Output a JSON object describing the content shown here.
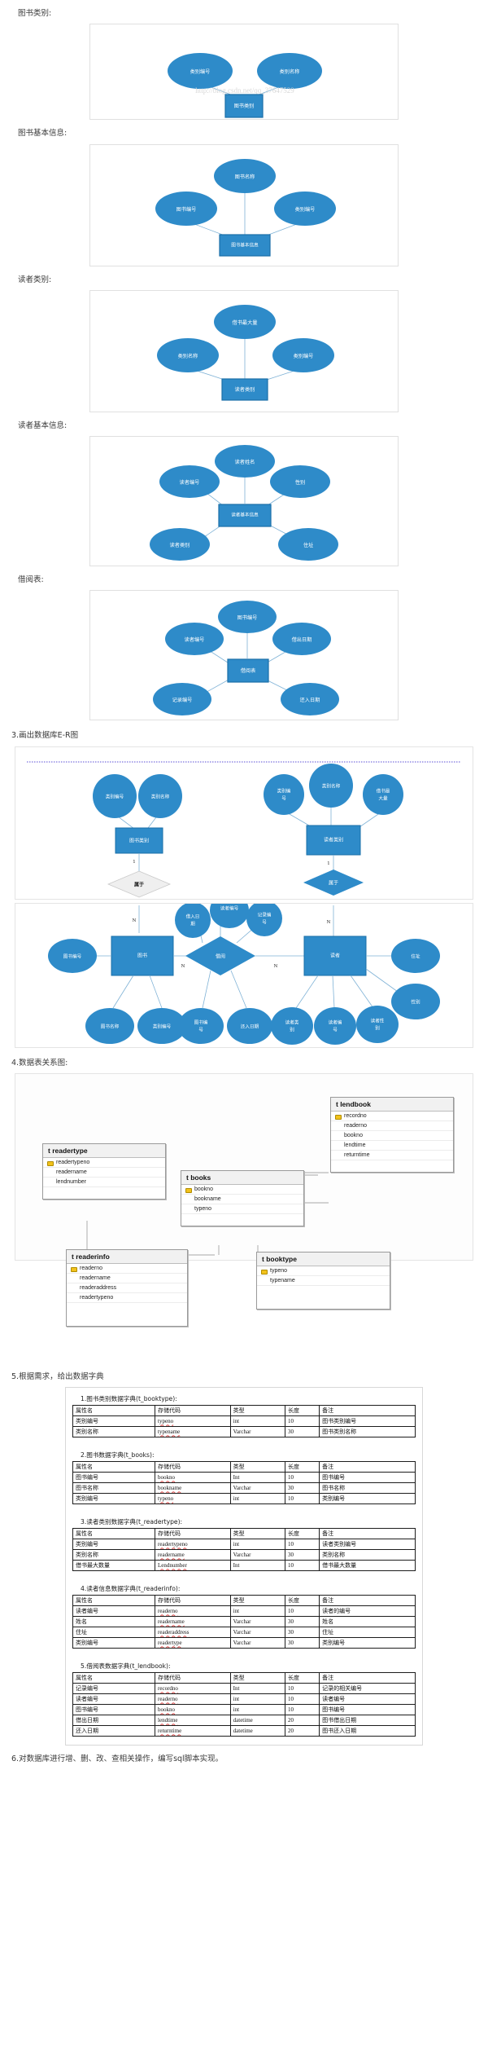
{
  "watermark": "http://blog.csdn.net/qq_37647529",
  "sections": {
    "booktype_label": "图书类别:",
    "bookinfo_label": "图书基本信息:",
    "readertype_label": "读者类别:",
    "readerinfo_label": "读者基本信息:",
    "lendbook_label": "借阅表:",
    "er_heading": "3.画出数据库E-R图",
    "rel_heading": "4.数据表关系图:",
    "dict_heading": "5.根据需求，给出数据字典",
    "footer": "6.对数据库进行增、删、改、查相关操作，编写sql脚本实现。"
  },
  "er_simple": {
    "booktype": {
      "center": "图书类别",
      "attrs": [
        "类别编号",
        "类别名称"
      ]
    },
    "bookinfo": {
      "center": "图书基本信息",
      "attrs": [
        "图书名称",
        "图书编号",
        "类别编号"
      ]
    },
    "readertype": {
      "center": "读者类别",
      "attrs": [
        "借书最大量",
        "类别名称",
        "类别编号"
      ]
    },
    "readerinfo": {
      "center": "读者基本信息",
      "attrs": [
        "读者姓名",
        "读者编号",
        "性别",
        "读者类别",
        "住址"
      ]
    },
    "lendbook": {
      "center": "借阅表",
      "attrs": [
        "图书编号",
        "读者编号",
        "借出日期",
        "记录编号",
        "还入日期"
      ]
    }
  },
  "er_big": {
    "entities": [
      "图书类别",
      "读者类别",
      "图书",
      "读者"
    ],
    "relationships": [
      "属于",
      "属于",
      "借阅"
    ],
    "attrs_booktype": [
      "类别编号",
      "类别名称"
    ],
    "attrs_readertype": [
      "类别编号",
      "类别名称",
      "借书最大量"
    ],
    "attrs_book": [
      "图书编号",
      "图书名称",
      "类别编号"
    ],
    "attrs_lend": [
      "借入日期",
      "读者编号",
      "记录编号",
      "图书编号",
      "还入日期"
    ],
    "attrs_reader": [
      "住址",
      "性别",
      "读者类别",
      "读者编号",
      "读者性别"
    ],
    "cardinalities": [
      "1",
      "N",
      "1",
      "N",
      "N",
      "N"
    ]
  },
  "tables": [
    {
      "name": "t readertype",
      "fields": [
        "readertypeno",
        "readername",
        "lendnumber"
      ],
      "pk": "readertypeno"
    },
    {
      "name": "t books",
      "fields": [
        "bookno",
        "bookname",
        "typeno"
      ],
      "pk": "bookno"
    },
    {
      "name": "t lendbook",
      "fields": [
        "recordno",
        "readerno",
        "bookno",
        "lendtime",
        "returntime"
      ],
      "pk": "recordno"
    },
    {
      "name": "t readerinfo",
      "fields": [
        "readerno",
        "readername",
        "readeraddress",
        "readertypeno"
      ],
      "pk": "readerno"
    },
    {
      "name": "t booktype",
      "fields": [
        "typeno",
        "typename"
      ],
      "pk": "typeno"
    }
  ],
  "dictionary": {
    "headers": [
      "属性名",
      "存储代码",
      "类型",
      "长度",
      "备注"
    ],
    "tables": [
      {
        "title": "1.图书类别数据字典(t_booktype):",
        "rows": [
          [
            "类别编号",
            "typeno",
            "int",
            "10",
            "图书类别编号"
          ],
          [
            "类别名称",
            "typename",
            "Varchar",
            "30",
            "图书类别名称"
          ]
        ]
      },
      {
        "title": "2.图书数据字典(t_books):",
        "rows": [
          [
            "图书编号",
            "bookno",
            "Int",
            "10",
            "图书编号"
          ],
          [
            "图书名称",
            "bookname",
            "Varchar",
            "30",
            "图书名称"
          ],
          [
            "类别编号",
            "typeno",
            "int",
            "10",
            "类别编号"
          ]
        ]
      },
      {
        "title": "3.读者类别数据字典(t_readertype):",
        "rows": [
          [
            "类别编号",
            "readertypeno",
            "int",
            "10",
            "读者类别编号"
          ],
          [
            "类别名称",
            "readername",
            "Varchar",
            "30",
            "类别名称"
          ],
          [
            "借书最大数量",
            "Lendnumber",
            "Int",
            "10",
            "借书最大数量"
          ]
        ]
      },
      {
        "title": "4.读者信息数据字典(t_readerinfo):",
        "rows": [
          [
            "读者编号",
            "readerno",
            "int",
            "10",
            "读者的编号"
          ],
          [
            "姓名",
            "readername",
            "Varchar",
            "30",
            "姓名"
          ],
          [
            "住址",
            "readeraddress",
            "Varchar",
            "30",
            "住址"
          ],
          [
            "类别编号",
            "readertype",
            "Varchar",
            "30",
            "类别编号"
          ]
        ]
      },
      {
        "title": "5.借阅表数据字典(t_lendbook):",
        "rows": [
          [
            "记录编号",
            "recordno",
            "Int",
            "10",
            "记录的相关编号"
          ],
          [
            "读者编号",
            "readerno",
            "int",
            "10",
            "读者编号"
          ],
          [
            "图书编号",
            "bookno",
            "int",
            "10",
            "图书编号"
          ],
          [
            "借出日期",
            "lendtime",
            "datetime",
            "20",
            "图书借出日期"
          ],
          [
            "还入日期",
            "returntime",
            "datetime",
            "20",
            "图书还入日期"
          ]
        ]
      }
    ]
  }
}
